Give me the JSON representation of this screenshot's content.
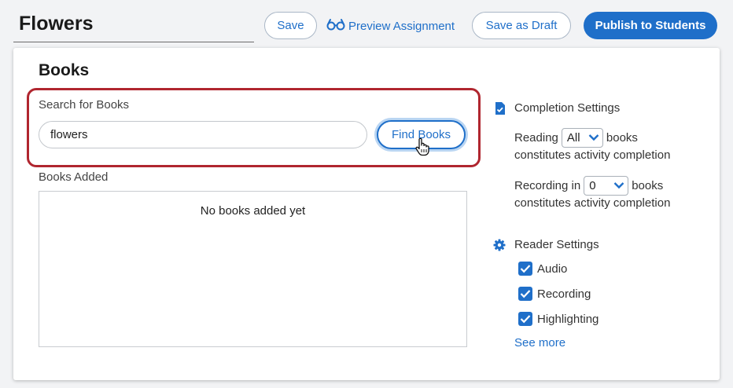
{
  "header": {
    "title": "Flowers",
    "save_label": "Save",
    "preview_label": "Preview Assignment",
    "draft_label": "Save as Draft",
    "publish_label": "Publish to Students"
  },
  "books": {
    "heading": "Books",
    "search_label": "Search for Books",
    "search_value": "flowers",
    "find_label": "Find Books",
    "added_label": "Books Added",
    "empty_text": "No books added yet"
  },
  "completion": {
    "heading": "Completion Settings",
    "reading_prefix": "Reading",
    "reading_value": "All",
    "reading_suffix": "books",
    "reading_line2": "constitutes activity completion",
    "recording_prefix": "Recording in",
    "recording_value": "0",
    "recording_suffix": "books",
    "recording_line2": "constitutes activity completion"
  },
  "reader": {
    "heading": "Reader Settings",
    "options": [
      {
        "label": "Audio",
        "checked": true
      },
      {
        "label": "Recording",
        "checked": true
      },
      {
        "label": "Highlighting",
        "checked": true
      }
    ],
    "see_more": "See more"
  },
  "colors": {
    "accent": "#1f6fc9",
    "highlight_border": "#b0262f"
  },
  "icons": {
    "preview": "glasses-icon",
    "completion": "document-check-icon",
    "reader": "gear-icon",
    "checkbox": "checkmark-icon",
    "cursor": "hand-pointer-icon"
  }
}
